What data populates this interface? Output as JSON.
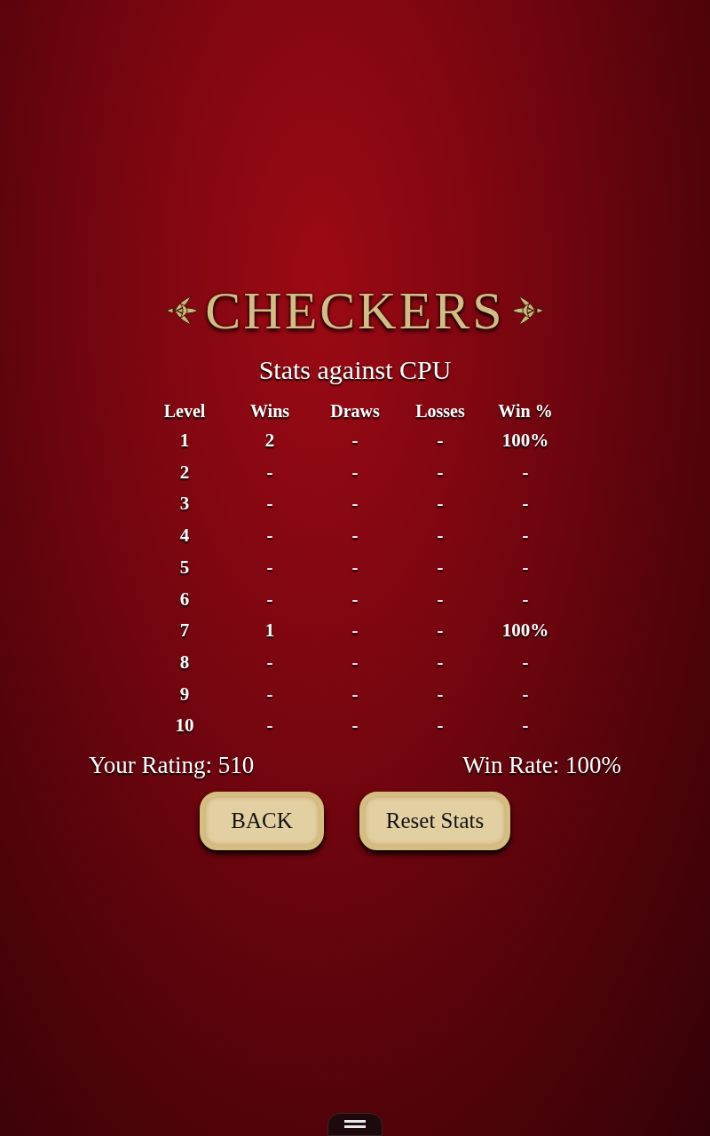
{
  "logo": {
    "title": "CHECKERS"
  },
  "heading": "Stats against CPU",
  "table": {
    "columns": [
      "Level",
      "Wins",
      "Draws",
      "Losses",
      "Win %"
    ],
    "rows": [
      [
        "1",
        "2",
        "-",
        "-",
        "100%"
      ],
      [
        "2",
        "-",
        "-",
        "-",
        "-"
      ],
      [
        "3",
        "-",
        "-",
        "-",
        "-"
      ],
      [
        "4",
        "-",
        "-",
        "-",
        "-"
      ],
      [
        "5",
        "-",
        "-",
        "-",
        "-"
      ],
      [
        "6",
        "-",
        "-",
        "-",
        "-"
      ],
      [
        "7",
        "1",
        "-",
        "-",
        "100%"
      ],
      [
        "8",
        "-",
        "-",
        "-",
        "-"
      ],
      [
        "9",
        "-",
        "-",
        "-",
        "-"
      ],
      [
        "10",
        "-",
        "-",
        "-",
        "-"
      ]
    ]
  },
  "summary": {
    "rating": "Your Rating: 510",
    "win_rate": "Win Rate: 100%"
  },
  "buttons": [
    "BACK",
    "Reset Stats"
  ]
}
